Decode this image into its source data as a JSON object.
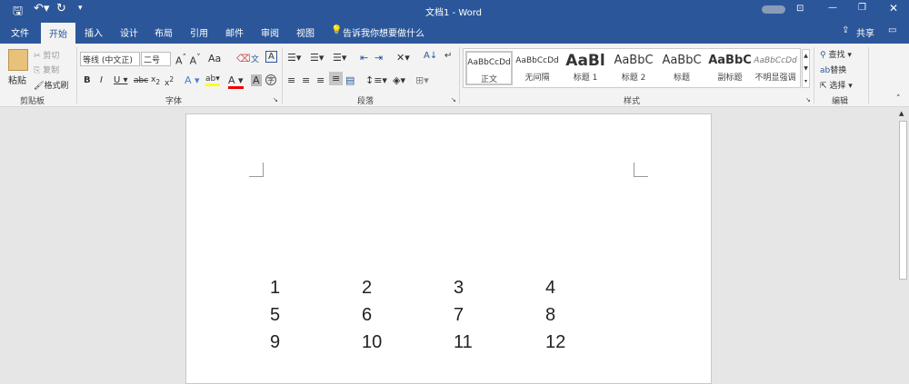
{
  "title": "文档1 - Word",
  "user": "",
  "tabs": [
    "文件",
    "开始",
    "插入",
    "设计",
    "布局",
    "引用",
    "邮件",
    "审阅",
    "视图"
  ],
  "tell_me": "告诉我你想要做什么",
  "share": "共享",
  "clipboard": {
    "paste": "粘贴",
    "cut": "剪切",
    "copy": "复制",
    "format_painter": "格式刷",
    "label": "剪贴板"
  },
  "font": {
    "name": "等线 (中文正)",
    "size": "二号",
    "label": "字体",
    "aa": "Aa"
  },
  "paragraph": {
    "label": "段落"
  },
  "styles": {
    "label": "样式",
    "items": [
      {
        "preview": "AaBbCcDd",
        "name": "正文"
      },
      {
        "preview": "AaBbCcDd",
        "name": "无间隔"
      },
      {
        "preview": "AaBl",
        "name": "标题 1"
      },
      {
        "preview": "AaBbC",
        "name": "标题 2"
      },
      {
        "preview": "AaBbC",
        "name": "标题"
      },
      {
        "preview": "AaBbC",
        "name": "副标题"
      },
      {
        "preview": "AaBbCcDd",
        "name": "不明显强调"
      }
    ]
  },
  "editing": {
    "find": "查找",
    "replace": "替换",
    "select": "选择",
    "label": "编辑"
  },
  "document": {
    "rows": [
      [
        "1",
        "2",
        "3",
        "4"
      ],
      [
        "5",
        "6",
        "7",
        "8"
      ],
      [
        "9",
        "10",
        "11",
        "12"
      ]
    ]
  }
}
